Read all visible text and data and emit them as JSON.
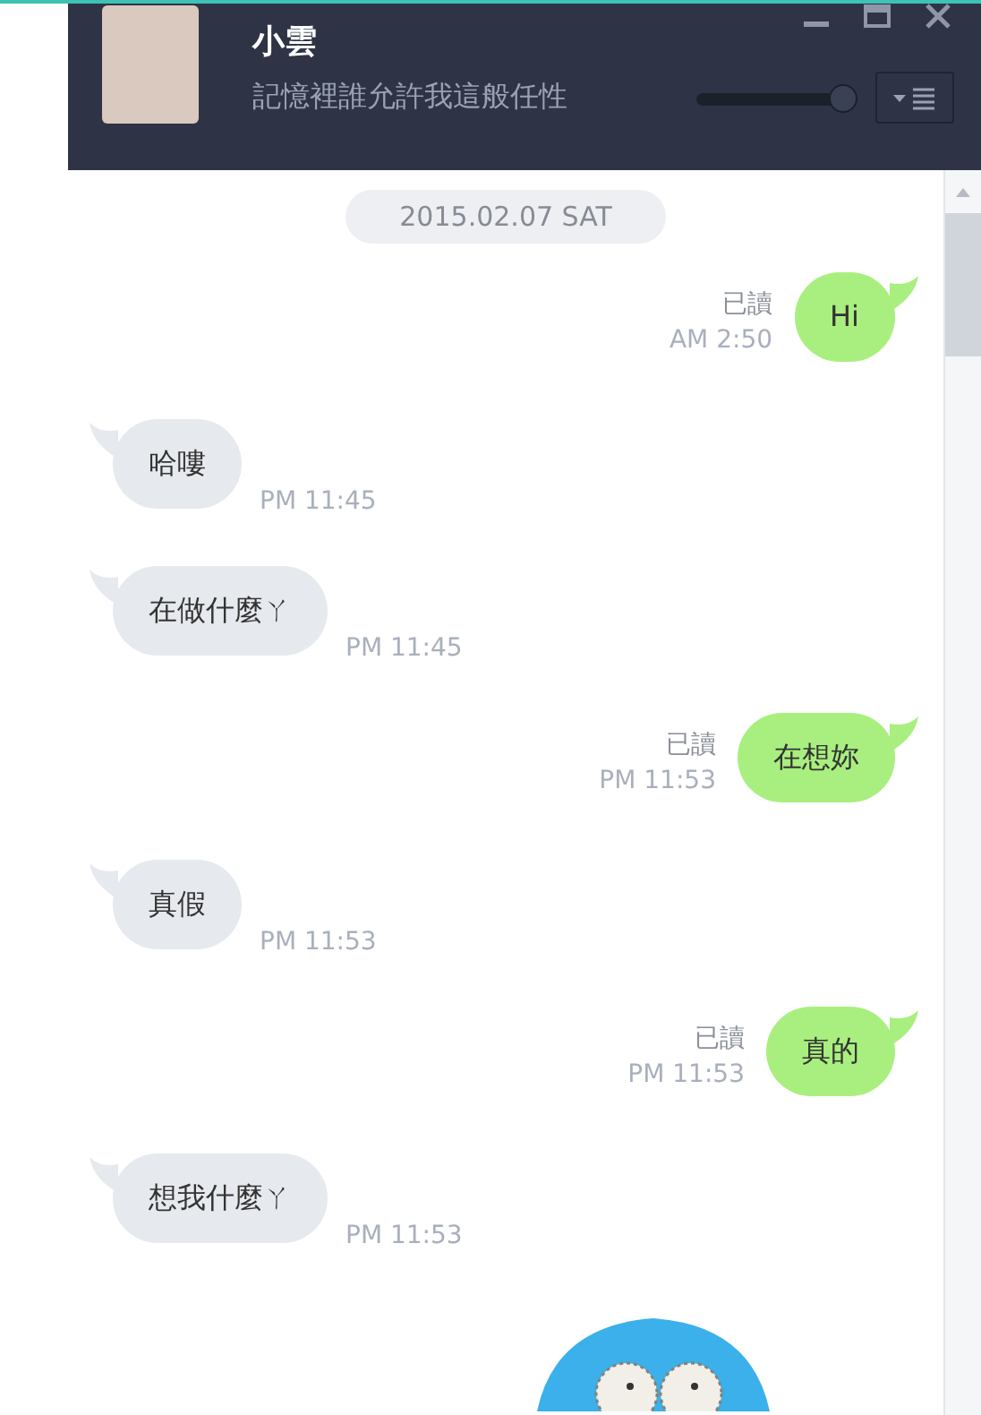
{
  "header": {
    "name": "小雲",
    "status": "記憶裡誰允許我這般任性",
    "zoom_slider": {
      "level": 0.93
    }
  },
  "date_label": "2015.02.07 SAT",
  "messages": [
    {
      "kind": "sent",
      "text": "Hi",
      "read": "已讀",
      "time": "AM 2:50"
    },
    {
      "kind": "received",
      "text": "哈嘍",
      "time": "PM 11:45"
    },
    {
      "kind": "received",
      "text": "在做什麼ㄚ",
      "time": "PM 11:45"
    },
    {
      "kind": "sent",
      "text": "在想妳",
      "read": "已讀",
      "time": "PM 11:53"
    },
    {
      "kind": "received",
      "text": "真假",
      "time": "PM 11:53"
    },
    {
      "kind": "sent",
      "text": "真的",
      "read": "已讀",
      "time": "PM 11:53"
    },
    {
      "kind": "received",
      "text": "想我什麼ㄚ",
      "time": "PM 11:53"
    },
    {
      "kind": "sticker"
    }
  ]
}
